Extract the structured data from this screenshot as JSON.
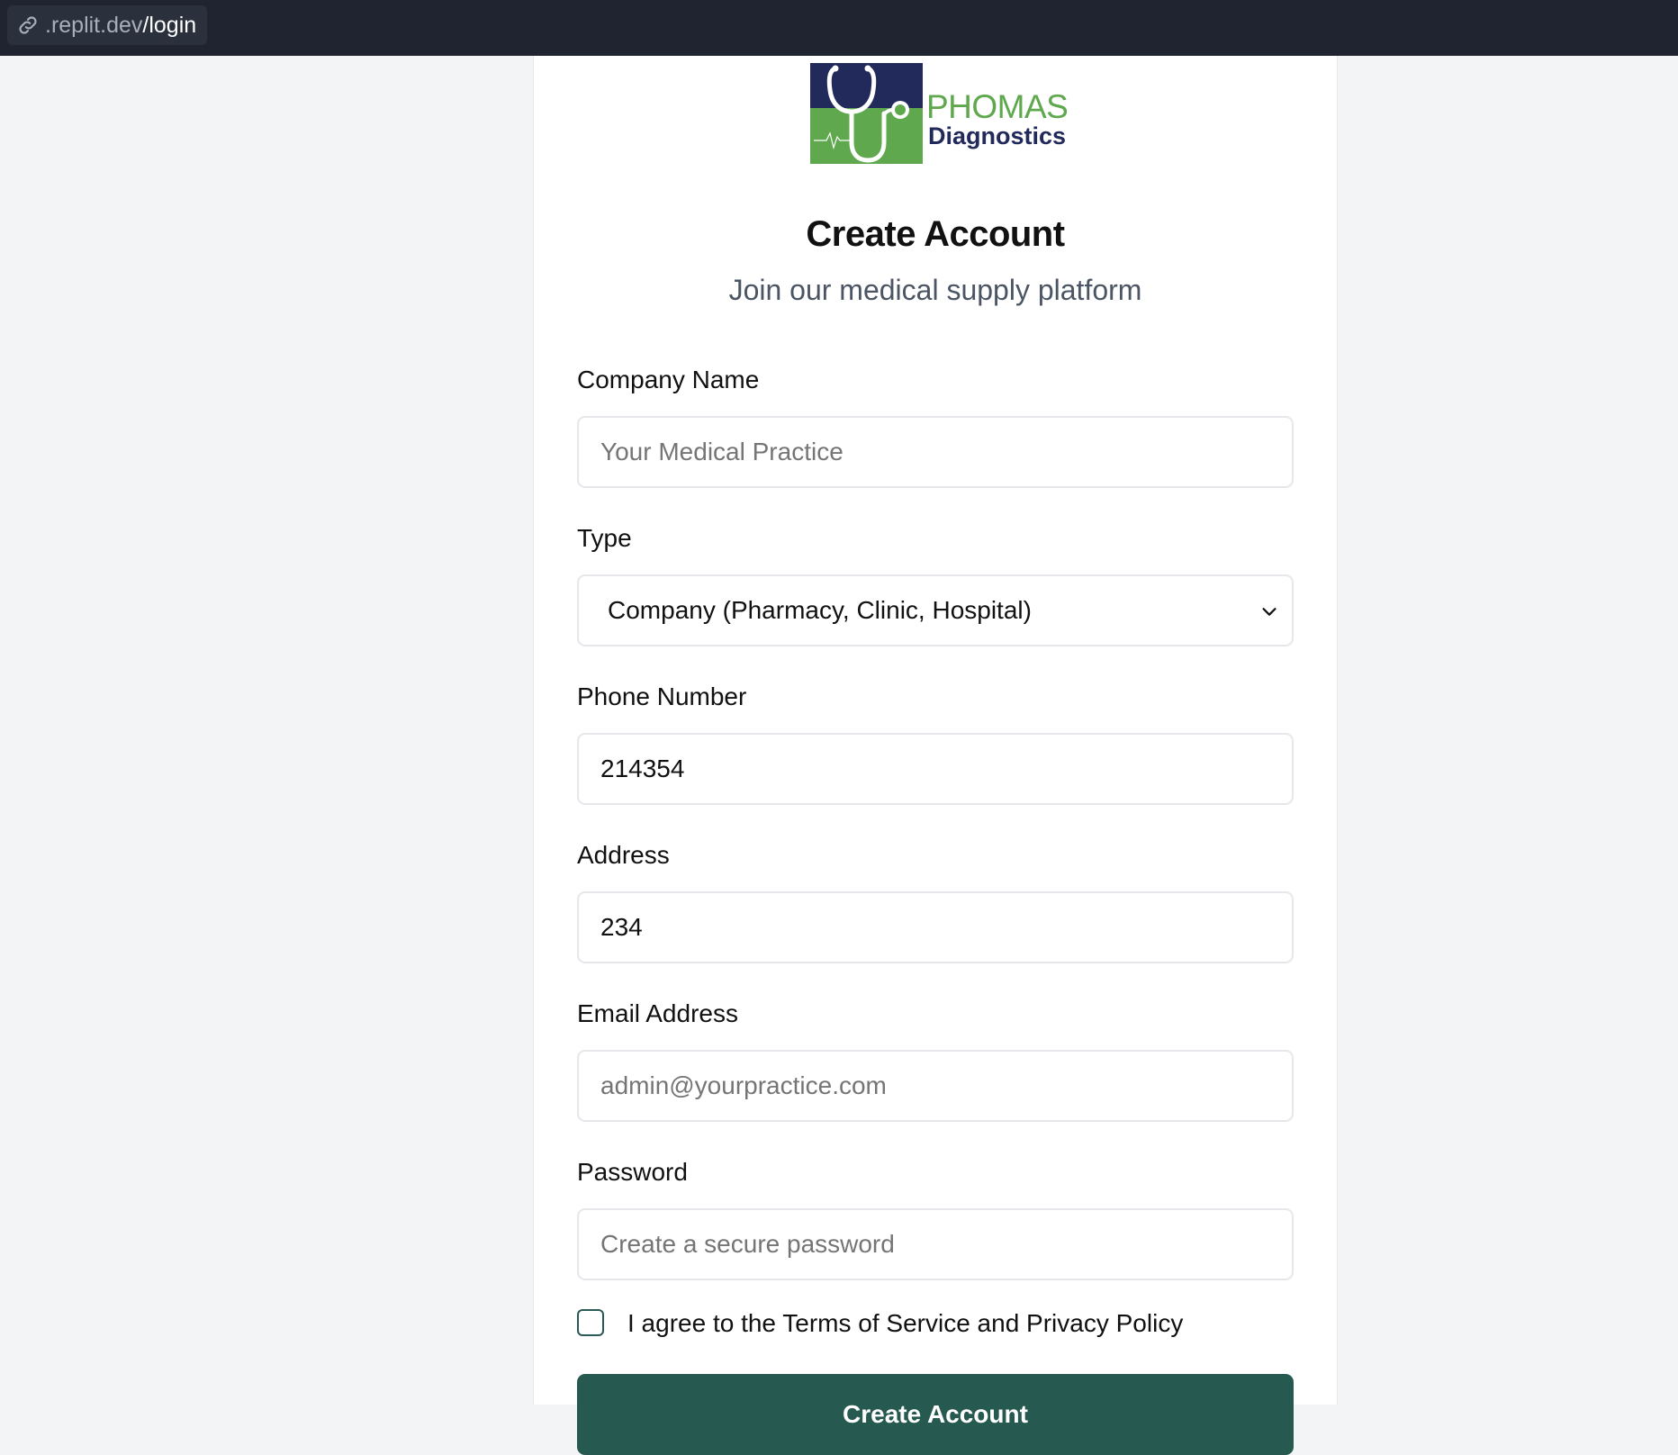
{
  "browser": {
    "url_domain": ".replit.dev",
    "url_path": "/login",
    "icon": "link-icon"
  },
  "logo": {
    "brand": "PHOMAS",
    "subtitle": "Diagnostics",
    "icon": "stethoscope-icon",
    "colors": {
      "navy": "#222a5c",
      "green": "#5fa84e"
    }
  },
  "form": {
    "title": "Create Account",
    "subtitle": "Join our medical supply platform",
    "company_name": {
      "label": "Company Name",
      "value": "",
      "placeholder": "Your Medical Practice"
    },
    "type": {
      "label": "Type",
      "selected": "Company (Pharmacy, Clinic, Hospital)"
    },
    "phone": {
      "label": "Phone Number",
      "value": "214354",
      "placeholder": ""
    },
    "address": {
      "label": "Address",
      "value": "234",
      "placeholder": ""
    },
    "email": {
      "label": "Email Address",
      "value": "",
      "placeholder": "admin@yourpractice.com"
    },
    "password": {
      "label": "Password",
      "value": "",
      "placeholder": "Create a secure password"
    },
    "terms": {
      "label": "I agree to the Terms of Service and Privacy Policy",
      "checked": false
    },
    "submit_label": "Create Account"
  },
  "colors": {
    "page_bg": "#f3f4f6",
    "topbar_bg": "#1f2430",
    "button_bg": "#26594f"
  }
}
